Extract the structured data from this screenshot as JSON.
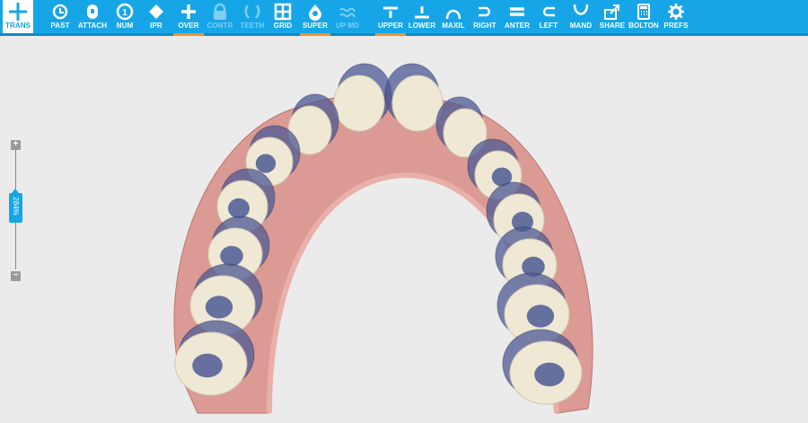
{
  "toolbar": {
    "tools": [
      {
        "label": "TRANS",
        "icon": "move-arrows-icon",
        "state": "first"
      },
      {
        "label": "PAST",
        "icon": "clock-back-icon",
        "state": "normal"
      },
      {
        "label": "ATTACH",
        "icon": "attachment-icon",
        "state": "normal"
      },
      {
        "label": "NUM",
        "icon": "number-circle-icon",
        "state": "normal"
      },
      {
        "label": "IPR",
        "icon": "diamond-icon",
        "state": "normal"
      },
      {
        "label": "OVER",
        "icon": "plus-icon",
        "state": "selected"
      },
      {
        "label": "CONTR",
        "icon": "lock-icon",
        "state": "disabled"
      },
      {
        "label": "TEETH",
        "icon": "teeth-icon",
        "state": "disabled"
      },
      {
        "label": "GRID",
        "icon": "grid-icon",
        "state": "normal"
      },
      {
        "label": "SUPER",
        "icon": "tooth-drop-icon",
        "state": "selected"
      },
      {
        "label": "UP MD",
        "icon": "scribble-icon",
        "state": "disabled"
      },
      {
        "label": "UPPER",
        "icon": "upper-bar-icon",
        "state": "selected"
      },
      {
        "label": "LOWER",
        "icon": "lower-bar-icon",
        "state": "normal"
      },
      {
        "label": "MAXIL",
        "icon": "arch-icon",
        "state": "normal"
      },
      {
        "label": "RIGHT",
        "icon": "right-view-icon",
        "state": "normal"
      },
      {
        "label": "ANTER",
        "icon": "anterior-view-icon",
        "state": "normal"
      },
      {
        "label": "LEFT",
        "icon": "left-view-icon",
        "state": "normal"
      },
      {
        "label": "MAND",
        "icon": "mandible-icon",
        "state": "normal"
      },
      {
        "label": "SHARE",
        "icon": "share-icon",
        "state": "normal"
      },
      {
        "label": "BOLTON",
        "icon": "calculator-icon",
        "state": "normal"
      },
      {
        "label": "PREFS",
        "icon": "gear-icon",
        "state": "normal"
      }
    ]
  },
  "zoom": {
    "value": "284%",
    "plus": "+",
    "minus": "−"
  },
  "colors": {
    "accent": "#16a6e7",
    "selected_underline": "#f39231",
    "gum": "#dc9a94",
    "tooth": "#efe8d4",
    "overlay": "#4d5a94"
  }
}
